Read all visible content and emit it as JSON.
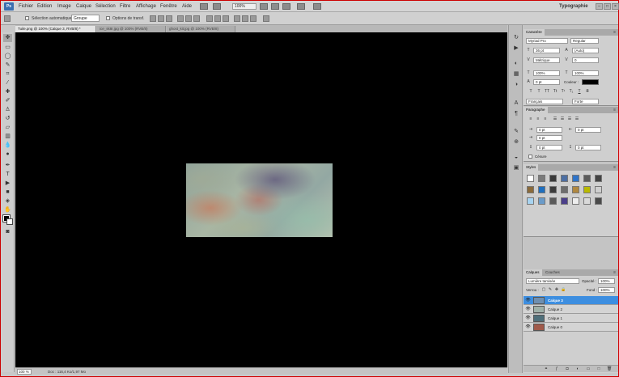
{
  "app": {
    "logo": "Ps",
    "workspace": "Typographie"
  },
  "menu": [
    "Fichier",
    "Edition",
    "Image",
    "Calque",
    "Sélection",
    "Filtre",
    "Affichage",
    "Fenêtre",
    "Aide"
  ],
  "menubar": {
    "zoom": "100%"
  },
  "options": {
    "auto_select_label": "Sélection automatique :",
    "auto_select_value": "Groupe",
    "transform_label": "Options de transf."
  },
  "tabs": [
    {
      "label": "Tuile.png @ 100% (Calque 3, RVB/8) *",
      "active": true
    },
    {
      "label": "ice_sk8r.jpg @ 100% (RVB/8)",
      "active": false
    },
    {
      "label": "ghost_kit.jpg @ 100% (RVB/8)",
      "active": false
    }
  ],
  "status": {
    "zoom": "100 %",
    "doc": "Doc : 116,4 Ko/1,97 Mo"
  },
  "character": {
    "tab": "Caractère",
    "font_family": "Myriad Pro",
    "font_style": "Regular",
    "size": "36 pt",
    "leading": "(Auto)",
    "kerning": "Métrique",
    "tracking": "0",
    "vscale": "100%",
    "hscale": "100%",
    "baseline": "0 pt",
    "color_label": "Couleur :",
    "language": "Français",
    "aa": "Forte",
    "style_buttons": [
      "T",
      "T",
      "TT",
      "Tt",
      "T¹",
      "T₁",
      "T",
      "T"
    ]
  },
  "paragraph": {
    "tab": "Paragraphe",
    "indent_left": "0 pt",
    "indent_right": "0 pt",
    "indent_first": "0 pt",
    "space_before": "0 pt",
    "space_after": "0 pt",
    "hyphenate": "Césure"
  },
  "styles": {
    "tab": "Styles",
    "colors": [
      "#ffffff",
      "#7a7a7a",
      "#3a3a3a",
      "#4d6fa3",
      "#2f74c9",
      "#5b5b5b",
      "#444444",
      "#8a6a3a",
      "#1f6fbf",
      "#3c3c3c",
      "#6d6d6d",
      "#b08840",
      "#b9b900",
      "#cfcfcf",
      "#a7d3f0",
      "#6a9bc9",
      "#5a5a5a",
      "#4b3f8a",
      "#ededed",
      "#d9d9d9",
      "#4a4a4a"
    ]
  },
  "layers": {
    "tabs": [
      "Calques",
      "Couches"
    ],
    "blend_mode": "Lumière tamisée",
    "opacity_label": "Opacité :",
    "opacity": "100%",
    "lock_label": "Verrou :",
    "fill_label": "Fond :",
    "fill": "100%",
    "items": [
      {
        "name": "Calque 3",
        "selected": true,
        "thumb": "#6f8fb0"
      },
      {
        "name": "Calque 2",
        "selected": false,
        "thumb": "#9fb0a8"
      },
      {
        "name": "Calque 1",
        "selected": false,
        "thumb": "#4f6f7a"
      },
      {
        "name": "Calque 0",
        "selected": false,
        "thumb": "#a05a4a"
      }
    ],
    "footer_icons": [
      "link-icon",
      "fx-icon",
      "mask-icon",
      "adjustment-icon",
      "group-icon",
      "new-layer-icon",
      "trash-icon"
    ]
  }
}
